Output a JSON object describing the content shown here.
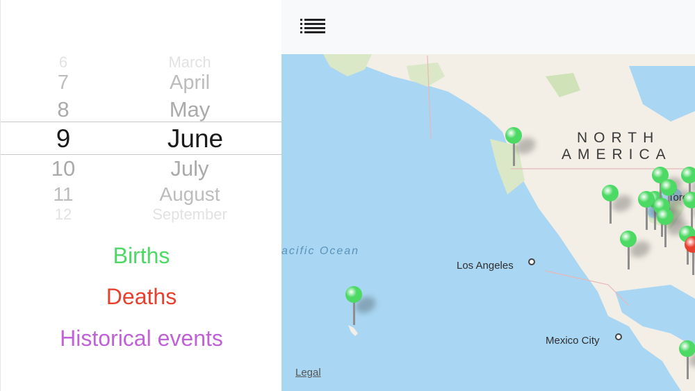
{
  "picker": {
    "rows": [
      {
        "day": "6",
        "month": "March"
      },
      {
        "day": "7",
        "month": "April"
      },
      {
        "day": "8",
        "month": "May"
      },
      {
        "day": "9",
        "month": "June"
      },
      {
        "day": "10",
        "month": "July"
      },
      {
        "day": "11",
        "month": "August"
      },
      {
        "day": "12",
        "month": "September"
      }
    ],
    "selected_index": 3
  },
  "categories": {
    "births": {
      "label": "Births",
      "color": "#4cd964"
    },
    "deaths": {
      "label": "Deaths",
      "color": "#e8402e"
    },
    "events": {
      "label": "Historical events",
      "color": "#c061d9"
    }
  },
  "map": {
    "list_icon": "list-icon",
    "labels": {
      "continent_line1": "NORTH",
      "continent_line2": "AMERICA",
      "ocean": "acific Ocean",
      "city_la": "Los Angeles",
      "city_toronto": "Toro",
      "city_mexico": "Mexico City"
    },
    "legal": "Legal",
    "pin_colors": {
      "green": "#4cd964",
      "red": "#e8402e"
    }
  }
}
